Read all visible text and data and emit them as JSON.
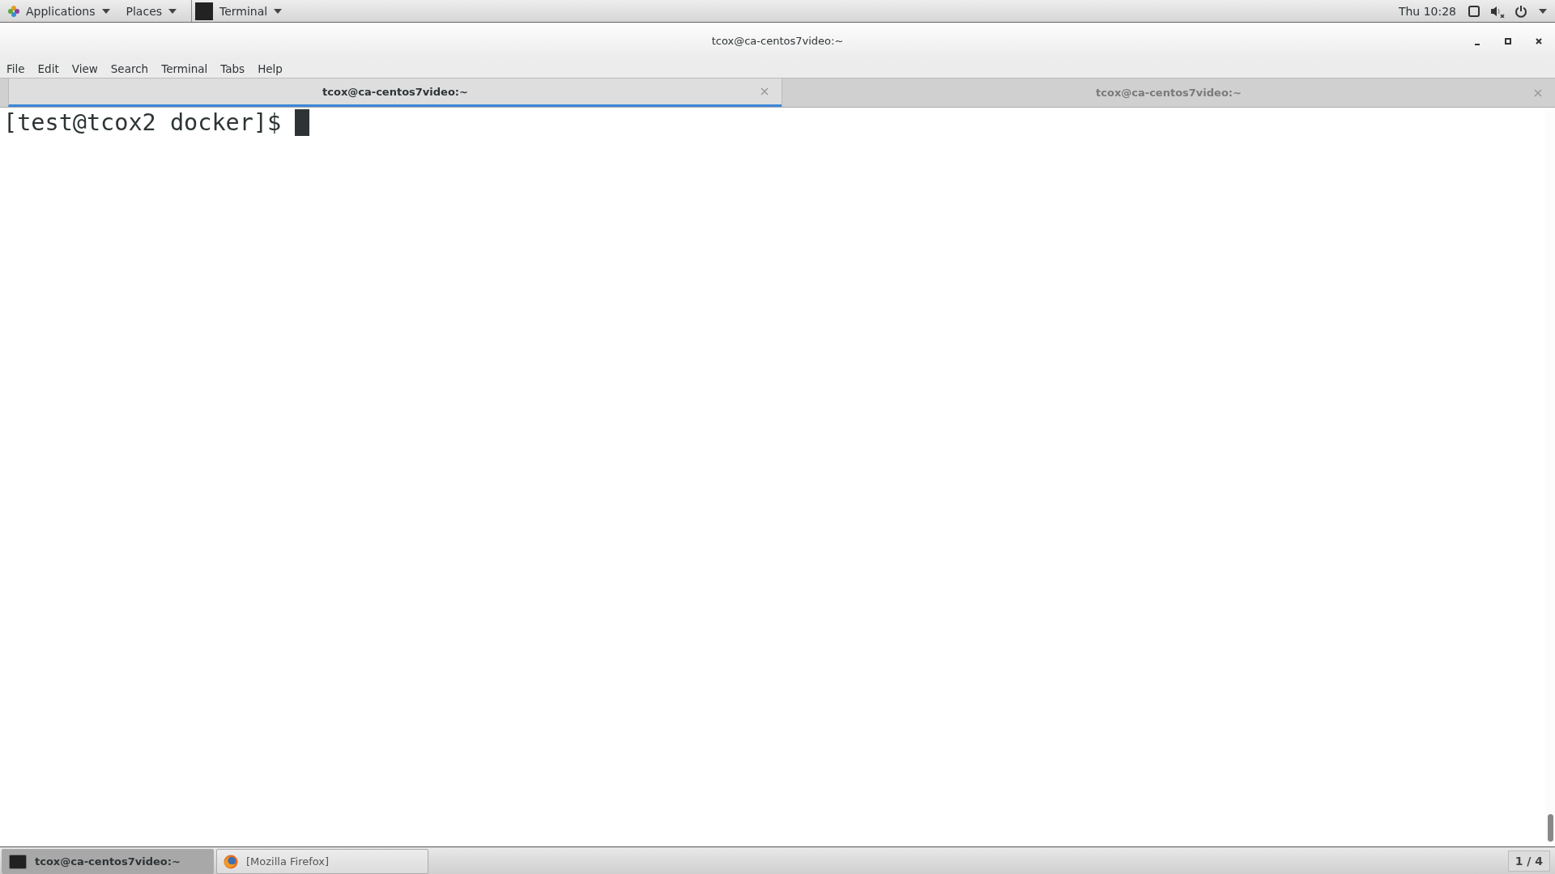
{
  "top_bar": {
    "menus": [
      {
        "label": "Applications"
      },
      {
        "label": "Places"
      }
    ],
    "active_app": {
      "label": "Terminal"
    },
    "clock": "Thu 10:28"
  },
  "window": {
    "title": "tcox@ca-centos7video:~"
  },
  "menu_bar": [
    "File",
    "Edit",
    "View",
    "Search",
    "Terminal",
    "Tabs",
    "Help"
  ],
  "tabs": [
    {
      "label": "tcox@ca-centos7video:~",
      "selected": true
    },
    {
      "label": "tcox@ca-centos7video:~",
      "selected": false
    }
  ],
  "terminal": {
    "lines": [
      "[test@tcox2 docker]$ "
    ],
    "cursor": true
  },
  "taskbar": {
    "items": [
      {
        "label": "tcox@ca-centos7video:~",
        "kind": "terminal",
        "selected": true
      },
      {
        "label": "[Mozilla Firefox]",
        "kind": "firefox",
        "selected": false
      }
    ],
    "workspace": "1 / 4"
  }
}
